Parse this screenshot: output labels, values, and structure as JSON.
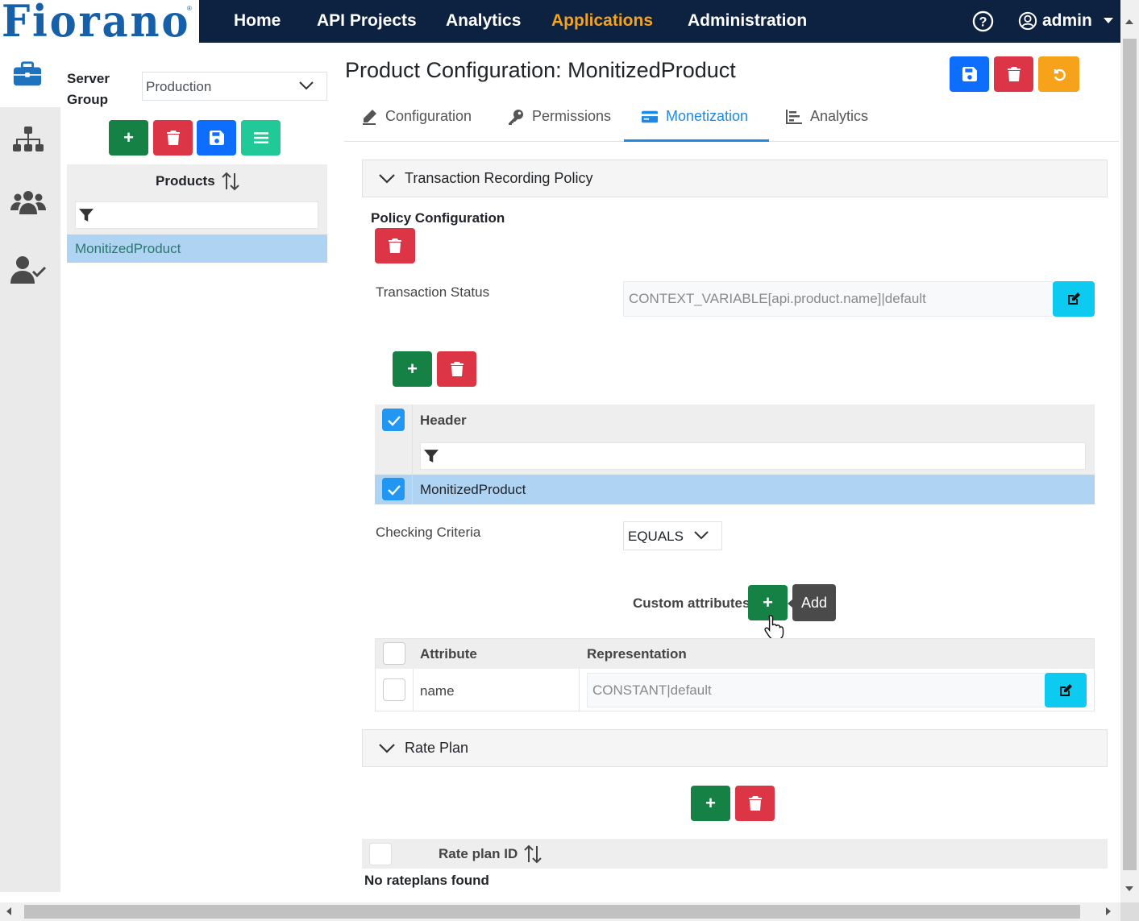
{
  "brand": {
    "logo_text": "Fiorano",
    "registered": "®"
  },
  "nav": {
    "items": [
      "Home",
      "API Projects",
      "Analytics",
      "Applications",
      "Administration"
    ],
    "active": "Applications",
    "user": "admin"
  },
  "left": {
    "server_group_label": [
      "Server",
      "Group"
    ],
    "server_group_value": "Production",
    "products_header": "Products",
    "products": [
      "MonitizedProduct"
    ]
  },
  "page": {
    "title": "Product Configuration: MonitizedProduct",
    "tabs": [
      "Configuration",
      "Permissions",
      "Monetization",
      "Analytics"
    ],
    "active_tab": "Monetization"
  },
  "transaction_policy": {
    "accordion_title": "Transaction Recording Policy",
    "policy_config_label": "Policy Configuration",
    "transaction_status_label": "Transaction Status",
    "transaction_status_value": "CONTEXT_VARIABLE[api.product.name]|default",
    "header_column": "Header",
    "header_rows": [
      "MonitizedProduct"
    ],
    "checking_criteria_label": "Checking Criteria",
    "checking_criteria_value": "EQUALS",
    "custom_attributes_label": "Custom attributes",
    "tooltip": "Add",
    "attr_columns": [
      "Attribute",
      "Representation"
    ],
    "attr_rows": [
      {
        "attribute": "name",
        "representation": "CONSTANT|default"
      }
    ]
  },
  "rate_plan": {
    "accordion_title": "Rate Plan",
    "column": "Rate plan ID",
    "empty_message": "No rateplans found"
  },
  "colors": {
    "navbar": "#0d2240",
    "active_nav": "#f7a21c",
    "success": "#168145",
    "danger": "#dc3545",
    "primary": "#0d6efd",
    "info": "#0dcaf0",
    "selection": "#aed3f3"
  }
}
